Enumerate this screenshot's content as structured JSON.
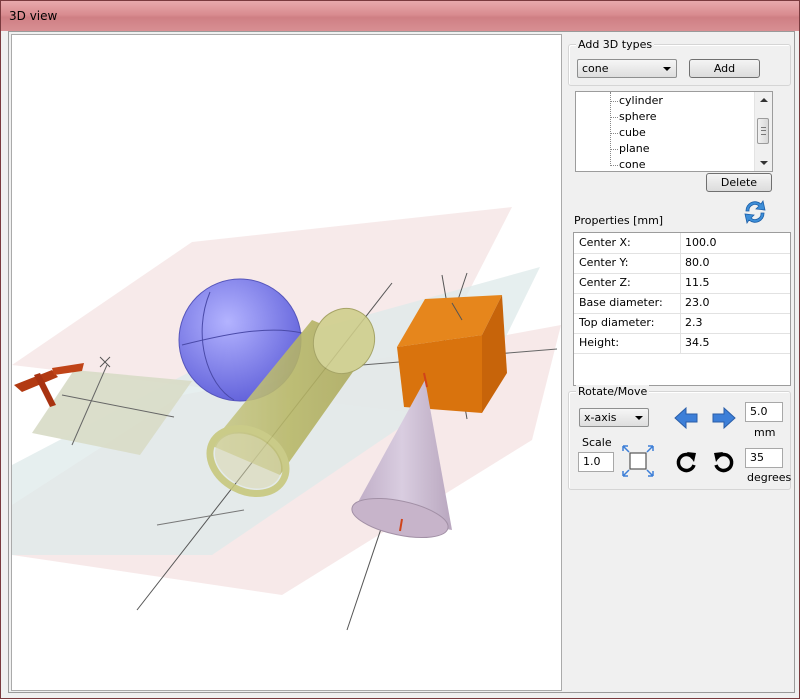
{
  "window": {
    "title": "3D view"
  },
  "add_group": {
    "title": "Add 3D types",
    "selected_type": "cone",
    "add_label": "Add"
  },
  "object_list": {
    "items": [
      "cylinder",
      "sphere",
      "cube",
      "plane",
      "cone"
    ],
    "delete_label": "Delete"
  },
  "properties": {
    "title": "Properties [mm]",
    "rows": [
      {
        "key": "Center X:",
        "value": "100.0"
      },
      {
        "key": "Center Y:",
        "value": "80.0"
      },
      {
        "key": "Center Z:",
        "value": "11.5"
      },
      {
        "key": "Base diameter:",
        "value": "23.0"
      },
      {
        "key": "Top diameter:",
        "value": "2.3"
      },
      {
        "key": "Height:",
        "value": "34.5"
      }
    ]
  },
  "rotate_move": {
    "title": "Rotate/Move",
    "axis": "x-axis",
    "move_step": "5.0",
    "move_unit": "mm",
    "scale_label": "Scale",
    "scale_value": "1.0",
    "rotate_step": "35",
    "rotate_unit": "degrees"
  },
  "icons": {
    "refresh": "refresh-icon",
    "move_left": "arrow-left-icon",
    "move_right": "arrow-right-icon",
    "fit_view": "fit-view-icon",
    "rotate_cw": "rotate-clockwise-icon",
    "rotate_ccw": "rotate-counterclockwise-icon",
    "arrow_blue": "#3d7fd8",
    "cube_orange": "#e07a10",
    "sphere_blue": "#7d7df2",
    "cylinder_olive": "#c8c77a",
    "cone_lilac": "#c9b8cf"
  }
}
